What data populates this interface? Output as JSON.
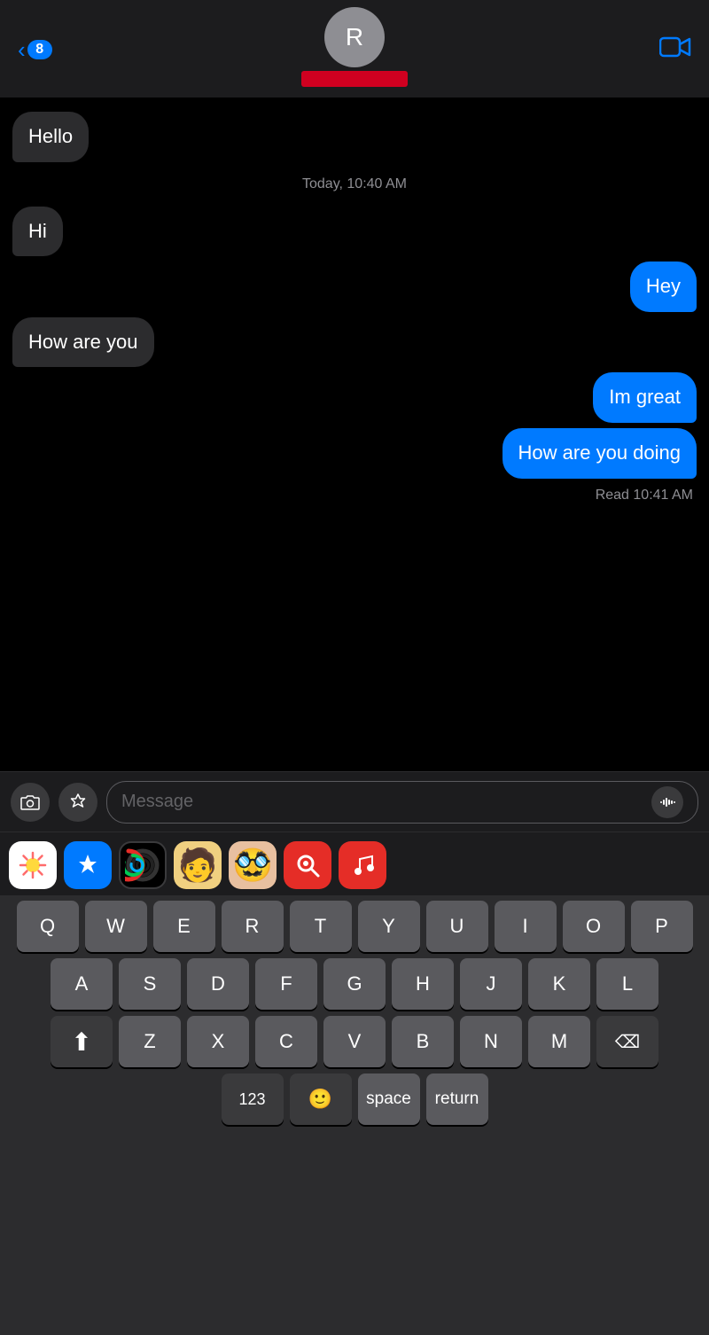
{
  "header": {
    "back_count": "8",
    "contact_initial": "R",
    "video_icon": "📹"
  },
  "messages": [
    {
      "id": "msg1",
      "text": "Hello",
      "type": "received"
    },
    {
      "id": "timestamp1",
      "text": "Today, 10:40 AM",
      "type": "timestamp"
    },
    {
      "id": "msg2",
      "text": "Hi",
      "type": "received"
    },
    {
      "id": "msg3",
      "text": "Hey",
      "type": "sent"
    },
    {
      "id": "msg4",
      "text": "How are you",
      "type": "received"
    },
    {
      "id": "msg5",
      "text": "Im great",
      "type": "sent"
    },
    {
      "id": "msg6",
      "text": "How are you doing",
      "type": "sent"
    },
    {
      "id": "read",
      "text": "Read 10:41 AM",
      "type": "read"
    }
  ],
  "input": {
    "placeholder": "Message"
  },
  "keyboard": {
    "rows": [
      [
        "Q",
        "W",
        "E",
        "R",
        "T",
        "Y",
        "U",
        "I",
        "O",
        "P"
      ],
      [
        "A",
        "S",
        "D",
        "F",
        "G",
        "H",
        "J",
        "K",
        "L"
      ],
      [
        "Z",
        "X",
        "C",
        "V",
        "B",
        "N",
        "M"
      ]
    ],
    "space_label": "space",
    "return_label": "return",
    "num_label": "123"
  }
}
